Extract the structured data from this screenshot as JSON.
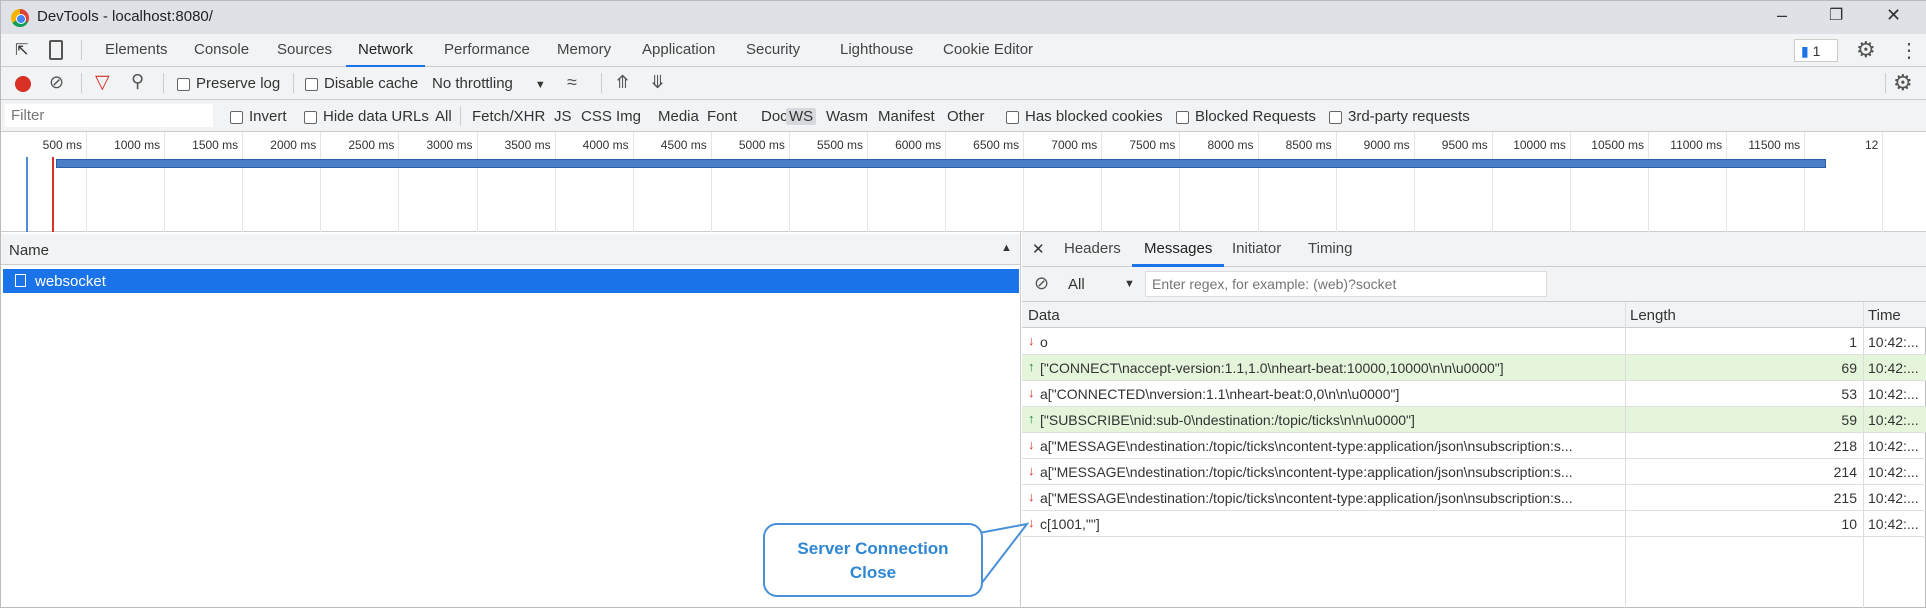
{
  "window": {
    "title": "DevTools - localhost:8080/"
  },
  "tabs": [
    "Elements",
    "Console",
    "Sources",
    "Network",
    "Performance",
    "Memory",
    "Application",
    "Security",
    "Lighthouse",
    "Cookie Editor"
  ],
  "active_tab": "Network",
  "issues_count": "1",
  "toolbar": {
    "preserve_log": "Preserve log",
    "disable_cache": "Disable cache",
    "throttling": "No throttling"
  },
  "filter": {
    "placeholder": "Filter",
    "invert": "Invert",
    "hide_data_urls": "Hide data URLs",
    "types": [
      "All",
      "Fetch/XHR",
      "JS",
      "CSS",
      "Img",
      "Media",
      "Font",
      "Doc",
      "WS",
      "Wasm",
      "Manifest",
      "Other"
    ],
    "active_type": "WS",
    "has_blocked_cookies": "Has blocked cookies",
    "blocked_requests": "Blocked Requests",
    "third_party": "3rd-party requests"
  },
  "timeline": {
    "ticks": [
      "500 ms",
      "1000 ms",
      "1500 ms",
      "2000 ms",
      "2500 ms",
      "3000 ms",
      "3500 ms",
      "4000 ms",
      "4500 ms",
      "5000 ms",
      "5500 ms",
      "6000 ms",
      "6500 ms",
      "7000 ms",
      "7500 ms",
      "8000 ms",
      "8500 ms",
      "9000 ms",
      "9500 ms",
      "10000 ms",
      "10500 ms",
      "11000 ms",
      "11500 ms",
      "12"
    ]
  },
  "requests": {
    "header": "Name",
    "items": [
      "websocket"
    ]
  },
  "detail": {
    "tabs": [
      "Headers",
      "Messages",
      "Initiator",
      "Timing"
    ],
    "active": "Messages",
    "filter_select": "All",
    "regex_placeholder": "Enter regex, for example: (web)?socket",
    "columns": [
      "Data",
      "Length",
      "Time"
    ],
    "messages": [
      {
        "dir": "down",
        "data": "o",
        "length": "1",
        "time": "10:42:..."
      },
      {
        "dir": "up",
        "data": "[\"CONNECT\\naccept-version:1.1,1.0\\nheart-beat:10000,10000\\n\\n\\u0000\"]",
        "length": "69",
        "time": "10:42:..."
      },
      {
        "dir": "down",
        "data": "a[\"CONNECTED\\nversion:1.1\\nheart-beat:0,0\\n\\n\\u0000\"]",
        "length": "53",
        "time": "10:42:..."
      },
      {
        "dir": "up",
        "data": "[\"SUBSCRIBE\\nid:sub-0\\ndestination:/topic/ticks\\n\\n\\u0000\"]",
        "length": "59",
        "time": "10:42:..."
      },
      {
        "dir": "down",
        "data": "a[\"MESSAGE\\ndestination:/topic/ticks\\ncontent-type:application/json\\nsubscription:s...",
        "length": "218",
        "time": "10:42:..."
      },
      {
        "dir": "down",
        "data": "a[\"MESSAGE\\ndestination:/topic/ticks\\ncontent-type:application/json\\nsubscription:s...",
        "length": "214",
        "time": "10:42:..."
      },
      {
        "dir": "down",
        "data": "a[\"MESSAGE\\ndestination:/topic/ticks\\ncontent-type:application/json\\nsubscription:s...",
        "length": "215",
        "time": "10:42:..."
      },
      {
        "dir": "down",
        "data": "c[1001,\"\"]",
        "length": "10",
        "time": "10:42:..."
      }
    ]
  },
  "callout": {
    "line1": "Server Connection",
    "line2": "Close"
  },
  "colors": {
    "accent": "#1a73e8",
    "up_row": "#e4f5dc",
    "down_arrow": "#d93025",
    "up_arrow": "#1e8e3e",
    "record": "#d93025"
  }
}
